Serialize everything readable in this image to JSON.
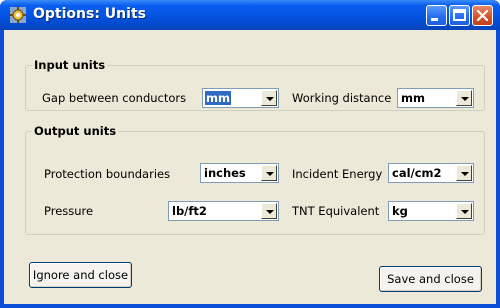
{
  "window": {
    "title": "Options: Units",
    "app_icon": "gear-icon",
    "controls": [
      "minimize-icon",
      "maximize-icon",
      "close-icon"
    ]
  },
  "input_units": {
    "legend": "Input units",
    "gap_label": "Gap between conductors",
    "gap_value": "mm",
    "distance_label": "Working distance",
    "distance_value": "mm"
  },
  "output_units": {
    "legend": "Output units",
    "protection_label": "Protection boundaries",
    "protection_value": "inches",
    "energy_label": "Incident Energy",
    "energy_value": "cal/cm2",
    "pressure_label": "Pressure",
    "pressure_value": "lb/ft2",
    "tnt_label": "TNT Equivalent",
    "tnt_value": "kg"
  },
  "buttons": {
    "ignore": "Ignore and close",
    "save": "Save and close"
  },
  "colors": {
    "titlebar": "#0553e0",
    "dialog_bg": "#ece9d8",
    "selection": "#316ac5",
    "close_button": "#d6542c"
  }
}
